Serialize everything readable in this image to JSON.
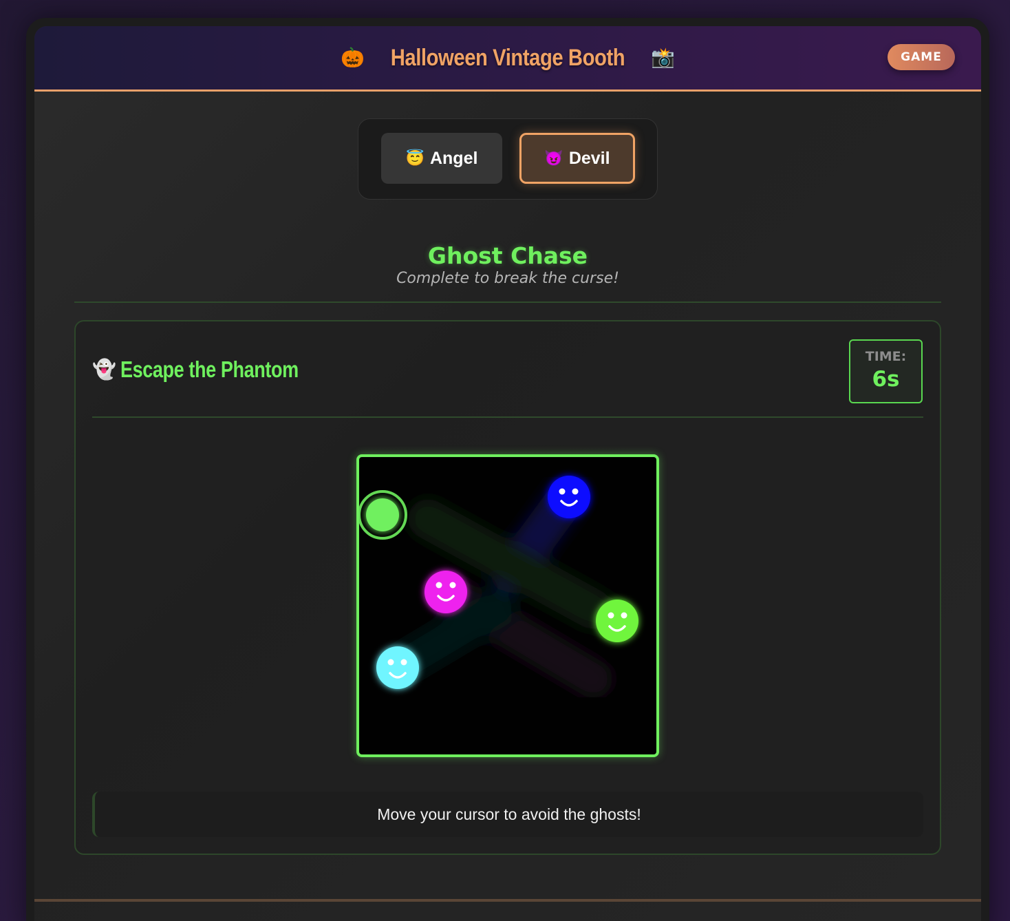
{
  "header": {
    "title": "Halloween Vintage Booth",
    "title_icon_left": "🎃",
    "title_icon_right": "📸",
    "badge_label": "GAME"
  },
  "mode_toggle": {
    "options": [
      {
        "label": "Angel",
        "icon": "😇",
        "selected": false
      },
      {
        "label": "Devil",
        "icon": "😈",
        "selected": true
      }
    ]
  },
  "section": {
    "title": "Ghost Chase",
    "subtitle": "Complete to break the curse!"
  },
  "game": {
    "name": "Escape the Phantom",
    "name_icon": "👻",
    "timer_label": "TIME:",
    "timer_value": "6s",
    "instructions": "Move your cursor to avoid the ghosts!",
    "ghost_colors": [
      "#1010ff",
      "#ee22ee",
      "#6ff53c",
      "#6ff5ff"
    ],
    "player_color": "#6ff05e"
  },
  "colors": {
    "accent_orange": "#f0a365",
    "accent_green": "#6ff05e"
  }
}
